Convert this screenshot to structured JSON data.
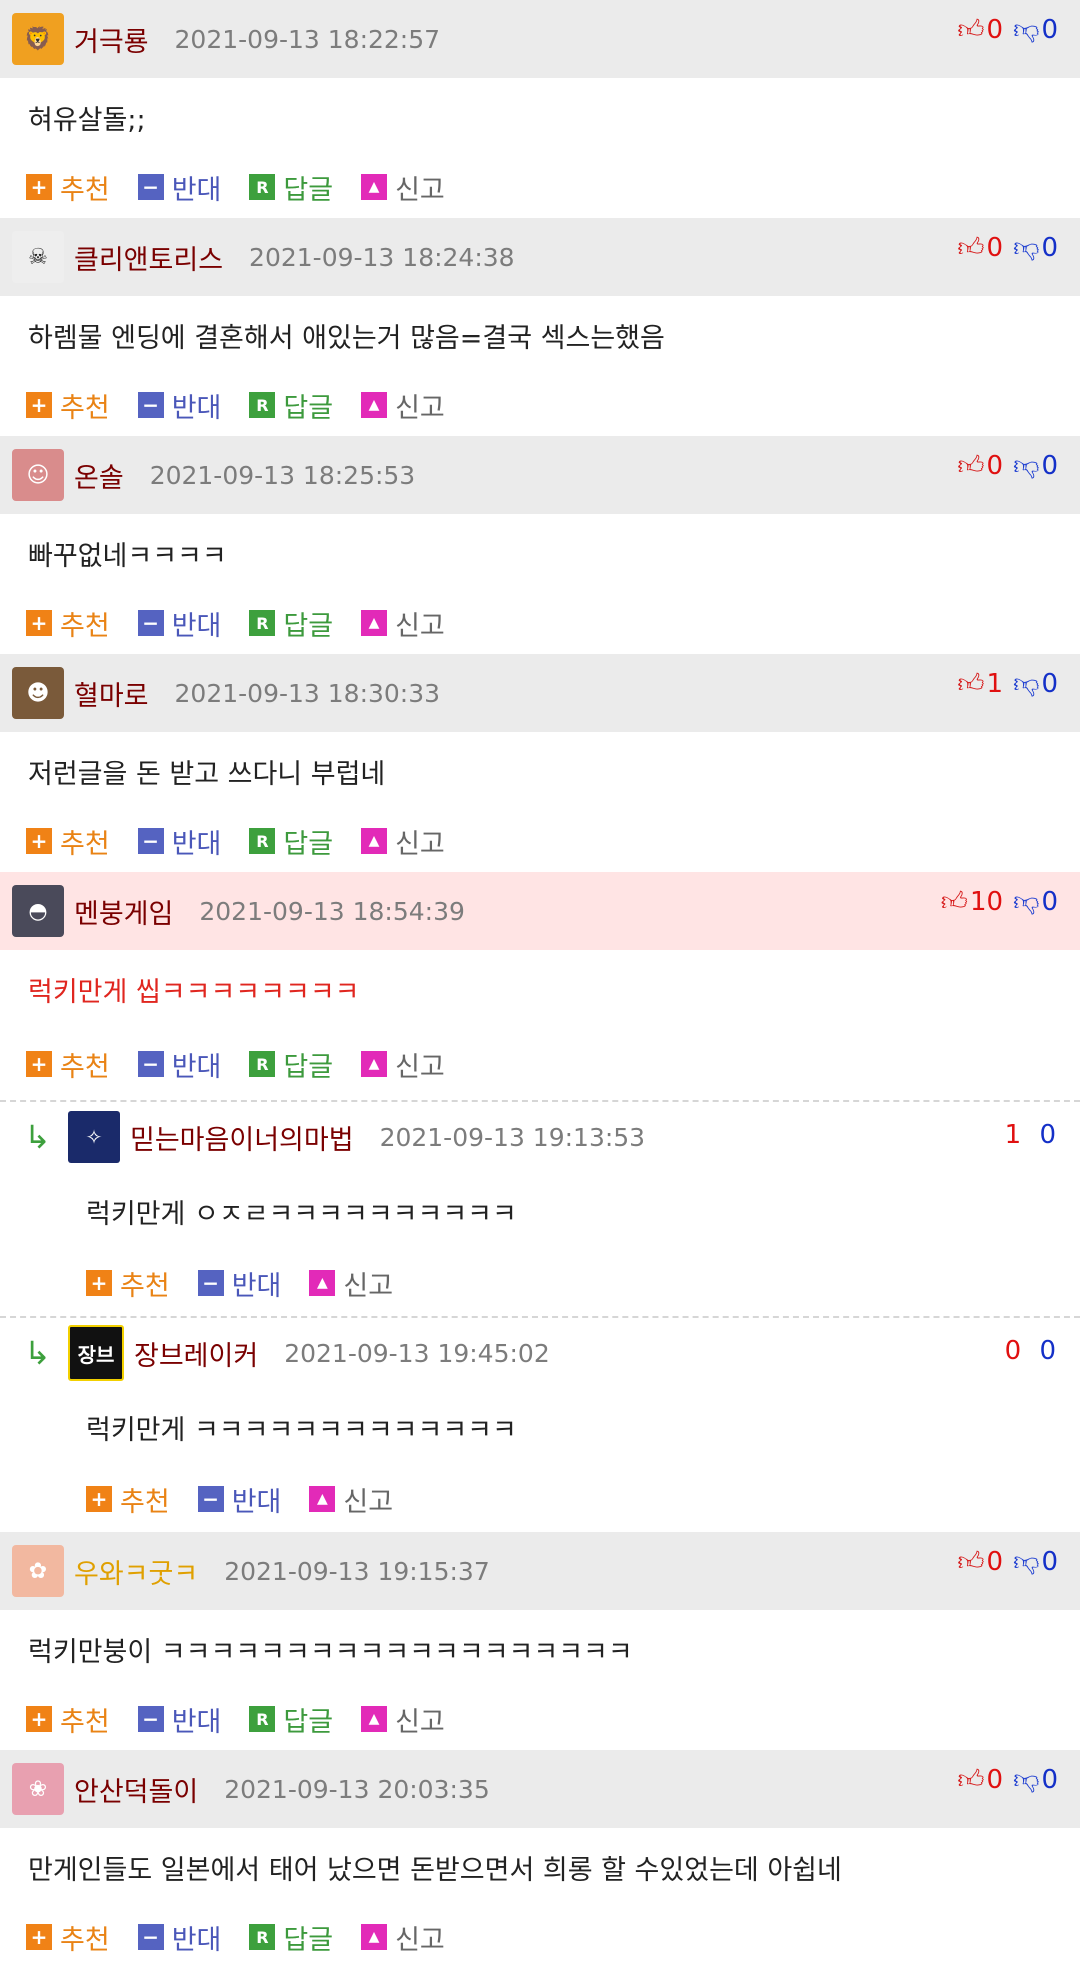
{
  "actions": {
    "up": "추천",
    "down": "반대",
    "reply": "답글",
    "report": "신고",
    "reply_glyph": "R"
  },
  "comments": [
    {
      "nick": "거극룡",
      "time": "2021-09-13 18:22:57",
      "up": "0",
      "down": "0",
      "text": "혀유살돌;;",
      "avatar_color": "#f0a020"
    },
    {
      "nick": "클리앤토리스",
      "time": "2021-09-13 18:24:38",
      "up": "0",
      "down": "0",
      "text": "하렘물 엔딩에 결혼해서 애있는거 많음=결국 섹스는했음",
      "avatar_color": "#333333"
    },
    {
      "nick": "온솔",
      "time": "2021-09-13 18:25:53",
      "up": "0",
      "down": "0",
      "text": "빠꾸없네ㅋㅋㅋㅋ",
      "avatar_color": "#d98c8c"
    },
    {
      "nick": "혈마로",
      "time": "2021-09-13 18:30:33",
      "up": "1",
      "down": "0",
      "text": "저런글을 돈 받고 쓰다니 부럽네",
      "avatar_color": "#7a5a3a"
    },
    {
      "nick": "멘붕게임",
      "time": "2021-09-13 18:54:39",
      "up": "10",
      "down": "0",
      "text": "럭키만게 씹ㅋㅋㅋㅋㅋㅋㅋㅋ",
      "avatar_color": "#4a4a5a"
    },
    {
      "nick": "우와ㅋ굿ㅋ",
      "time": "2021-09-13 19:15:37",
      "up": "0",
      "down": "0",
      "text": "럭키만붕이 ㅋㅋㅋㅋㅋㅋㅋㅋㅋㅋㅋㅋㅋㅋㅋㅋㅋㅋㅋ",
      "avatar_color": "#f2b8a0"
    },
    {
      "nick": "안산덕돌이",
      "time": "2021-09-13 20:03:35",
      "up": "0",
      "down": "0",
      "text": "만게인들도 일본에서 태어 났으면 돈받으면서 희롱 할 수있었는데 아쉽네",
      "avatar_color": "#e8a0b0"
    }
  ],
  "replies": [
    {
      "nick": "믿는마음이너의마법",
      "time": "2021-09-13 19:13:53",
      "up": "1",
      "down": "0",
      "text": "럭키만게 ㅇㅈㄹㅋㅋㅋㅋㅋㅋㅋㅋㅋㅋ",
      "avatar_color": "#1a2a6a",
      "avatar_text": ""
    },
    {
      "nick": "장브레이커",
      "time": "2021-09-13 19:45:02",
      "up": "0",
      "down": "0",
      "text": "럭키만게 ㅋㅋㅋㅋㅋㅋㅋㅋㅋㅋㅋㅋㅋ",
      "avatar_color": "#111111",
      "avatar_text": "장브"
    }
  ]
}
